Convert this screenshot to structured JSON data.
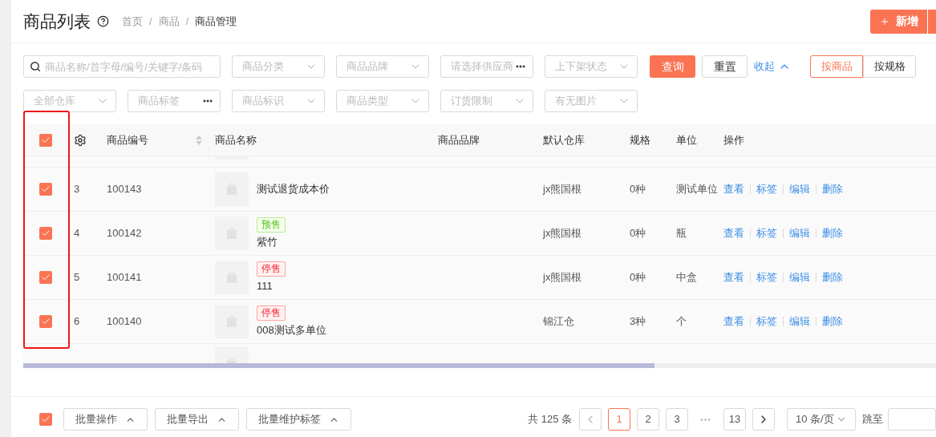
{
  "header": {
    "title": "商品列表",
    "breadcrumb": [
      {
        "kind": "link",
        "label": "首页",
        "current": false
      },
      {
        "kind": "separator",
        "label": "/"
      },
      {
        "kind": "link",
        "label": "商品",
        "current": false
      },
      {
        "kind": "separator",
        "label": "/"
      },
      {
        "kind": "link",
        "label": "商品管理",
        "current": true
      }
    ],
    "new_button": "新增"
  },
  "filter_rows": [
    {
      "fields": [
        {
          "kind": "search",
          "placeholder": "商品名称/首字母/编号/关键字/条码"
        },
        {
          "kind": "select",
          "placeholder": "商品分类"
        },
        {
          "kind": "select",
          "placeholder": "商品品牌"
        },
        {
          "kind": "picker",
          "placeholder": "请选择供应商"
        },
        {
          "kind": "select",
          "placeholder": "上下架状态"
        }
      ]
    },
    {
      "fields": [
        {
          "kind": "select",
          "placeholder": "全部仓库"
        },
        {
          "kind": "picker",
          "placeholder": "商品标签"
        },
        {
          "kind": "select",
          "placeholder": "商品标识"
        },
        {
          "kind": "select",
          "placeholder": "商品类型"
        },
        {
          "kind": "select",
          "placeholder": "订货限制"
        },
        {
          "kind": "select",
          "placeholder": "有无图片"
        }
      ]
    }
  ],
  "query_button": "查询",
  "reset_button": "重置",
  "collapse_link": "收起",
  "view_toggle": [
    {
      "label": "按商品",
      "selected": true
    },
    {
      "label": "按规格",
      "selected": false
    }
  ],
  "table": {
    "header_checked": true,
    "columns": [
      {
        "label": "商品编号",
        "sortable": true
      },
      {
        "label": "商品名称",
        "sortable": false
      },
      {
        "label": "商品品牌",
        "sortable": false
      },
      {
        "label": "默认仓库",
        "sortable": false
      },
      {
        "label": "规格",
        "sortable": false
      },
      {
        "label": "单位",
        "sortable": false
      },
      {
        "label": "操作",
        "sortable": false
      }
    ],
    "rows": [
      {
        "checked": true,
        "index": "3",
        "code": "100143",
        "name": "测试退货成本价",
        "warehouse": "jx熊国根",
        "spec": "0种",
        "unit": "测试单位",
        "actions": [
          "查看",
          "标签",
          "编辑",
          "删除"
        ]
      },
      {
        "checked": true,
        "index": "4",
        "code": "100142",
        "tag": {
          "kind": "presale",
          "label": "预售"
        },
        "name": "紫竹",
        "warehouse": "jx熊国根",
        "spec": "0种",
        "unit": "瓶",
        "actions": [
          "查看",
          "标签",
          "编辑",
          "删除"
        ]
      },
      {
        "checked": true,
        "index": "5",
        "code": "100141",
        "tag": {
          "kind": "stopped",
          "label": "停售"
        },
        "name": "111",
        "warehouse": "jx熊国根",
        "spec": "0种",
        "unit": "中盒",
        "actions": [
          "查看",
          "标签",
          "编辑",
          "删除"
        ]
      },
      {
        "checked": true,
        "index": "6",
        "code": "100140",
        "tag": {
          "kind": "stopped",
          "label": "停售"
        },
        "name": "008测试多单位",
        "warehouse": "锦江仓",
        "spec": "3种",
        "unit": "个",
        "actions": [
          "查看",
          "标签",
          "编辑",
          "删除"
        ]
      }
    ]
  },
  "footer": {
    "select_all_checked": true,
    "batch_buttons": [
      "批量操作",
      "批量导出",
      "批量维护标签"
    ],
    "total": "共 125 条",
    "pages": [
      {
        "kind": "prev"
      },
      {
        "kind": "page",
        "label": "1",
        "selected": true
      },
      {
        "kind": "page",
        "label": "2",
        "selected": false
      },
      {
        "kind": "page",
        "label": "3",
        "selected": false
      },
      {
        "kind": "ellipsis",
        "label": "•••"
      },
      {
        "kind": "page",
        "label": "13",
        "selected": false
      },
      {
        "kind": "next"
      }
    ],
    "page_size": "10 条/页",
    "jump_label": "跳至"
  }
}
